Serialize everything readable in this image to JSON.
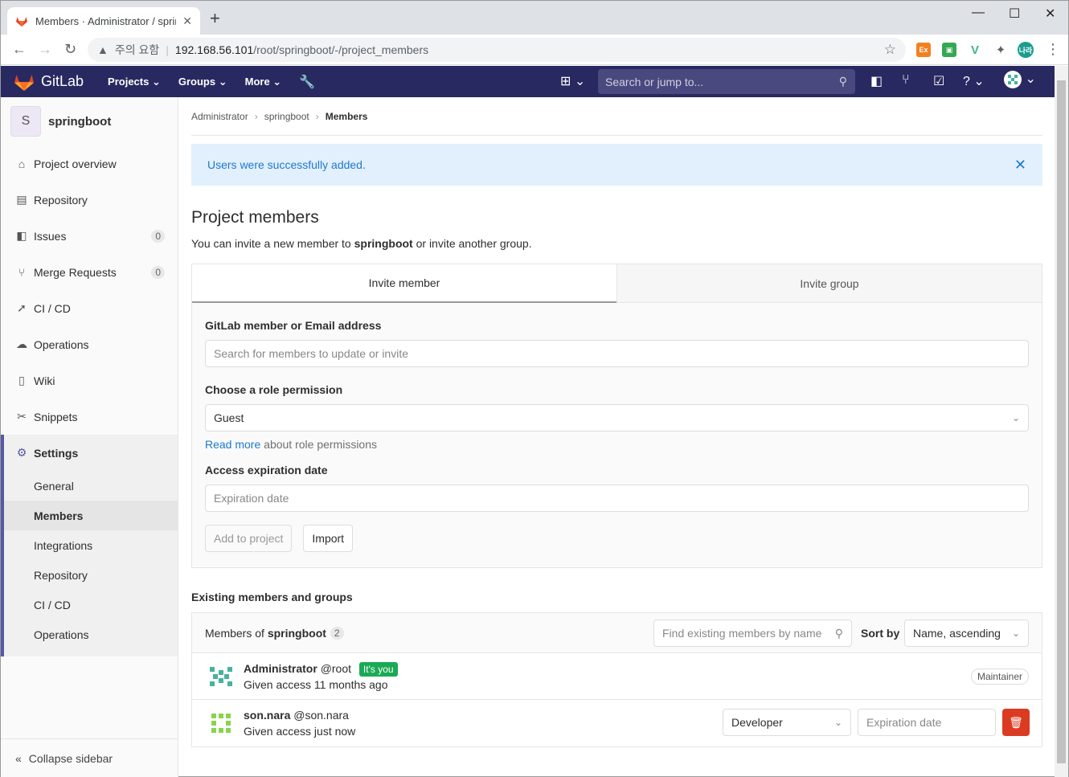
{
  "browser": {
    "tab_title": "Members · Administrator / springboot",
    "url_warning": "주의 요함",
    "url_host": "192.168.56.101",
    "url_path": "/root/springboot/-/project_members",
    "ext_avatar": "나라"
  },
  "navbar": {
    "brand": "GitLab",
    "menu": [
      "Projects",
      "Groups",
      "More"
    ],
    "search_placeholder": "Search or jump to..."
  },
  "sidebar": {
    "project_initial": "S",
    "project_name": "springboot",
    "items": [
      {
        "label": "Project overview",
        "icon": "home-icon"
      },
      {
        "label": "Repository",
        "icon": "doc-icon"
      },
      {
        "label": "Issues",
        "icon": "issues-icon",
        "badge": "0"
      },
      {
        "label": "Merge Requests",
        "icon": "merge-icon",
        "badge": "0"
      },
      {
        "label": "CI / CD",
        "icon": "rocket-icon"
      },
      {
        "label": "Operations",
        "icon": "cloud-icon"
      },
      {
        "label": "Wiki",
        "icon": "book-icon"
      },
      {
        "label": "Snippets",
        "icon": "scissors-icon"
      }
    ],
    "settings_label": "Settings",
    "settings_sub": [
      "General",
      "Members",
      "Integrations",
      "Repository",
      "CI / CD",
      "Operations"
    ],
    "collapse_label": "Collapse sidebar"
  },
  "breadcrumb": [
    "Administrator",
    "springboot",
    "Members"
  ],
  "flash": {
    "message": "Users were successfully added."
  },
  "page": {
    "title": "Project members",
    "desc_prefix": "You can invite a new member to ",
    "desc_project": "springboot",
    "desc_suffix": " or invite another group."
  },
  "invite": {
    "tab_member": "Invite member",
    "tab_group": "Invite group",
    "member_label": "GitLab member or Email address",
    "member_placeholder": "Search for members to update or invite",
    "role_label": "Choose a role permission",
    "role_value": "Guest",
    "read_more": "Read more",
    "read_more_suffix": " about role permissions",
    "expiration_label": "Access expiration date",
    "expiration_placeholder": "Expiration date",
    "add_button": "Add to project",
    "import_button": "Import"
  },
  "existing": {
    "title": "Existing members and groups",
    "members_of": "Members of ",
    "project": "springboot",
    "count": "2",
    "find_placeholder": "Find existing members by name",
    "sort_label": "Sort by",
    "sort_value": "Name, ascending"
  },
  "members": [
    {
      "name": "Administrator",
      "username": "@root",
      "badge": "It's you",
      "access": "Given access 11 months ago",
      "role": "Maintainer"
    },
    {
      "name": "son.nara",
      "username": "@son.nara",
      "access": "Given access just now",
      "role": "Developer",
      "expiration_placeholder": "Expiration date"
    }
  ]
}
